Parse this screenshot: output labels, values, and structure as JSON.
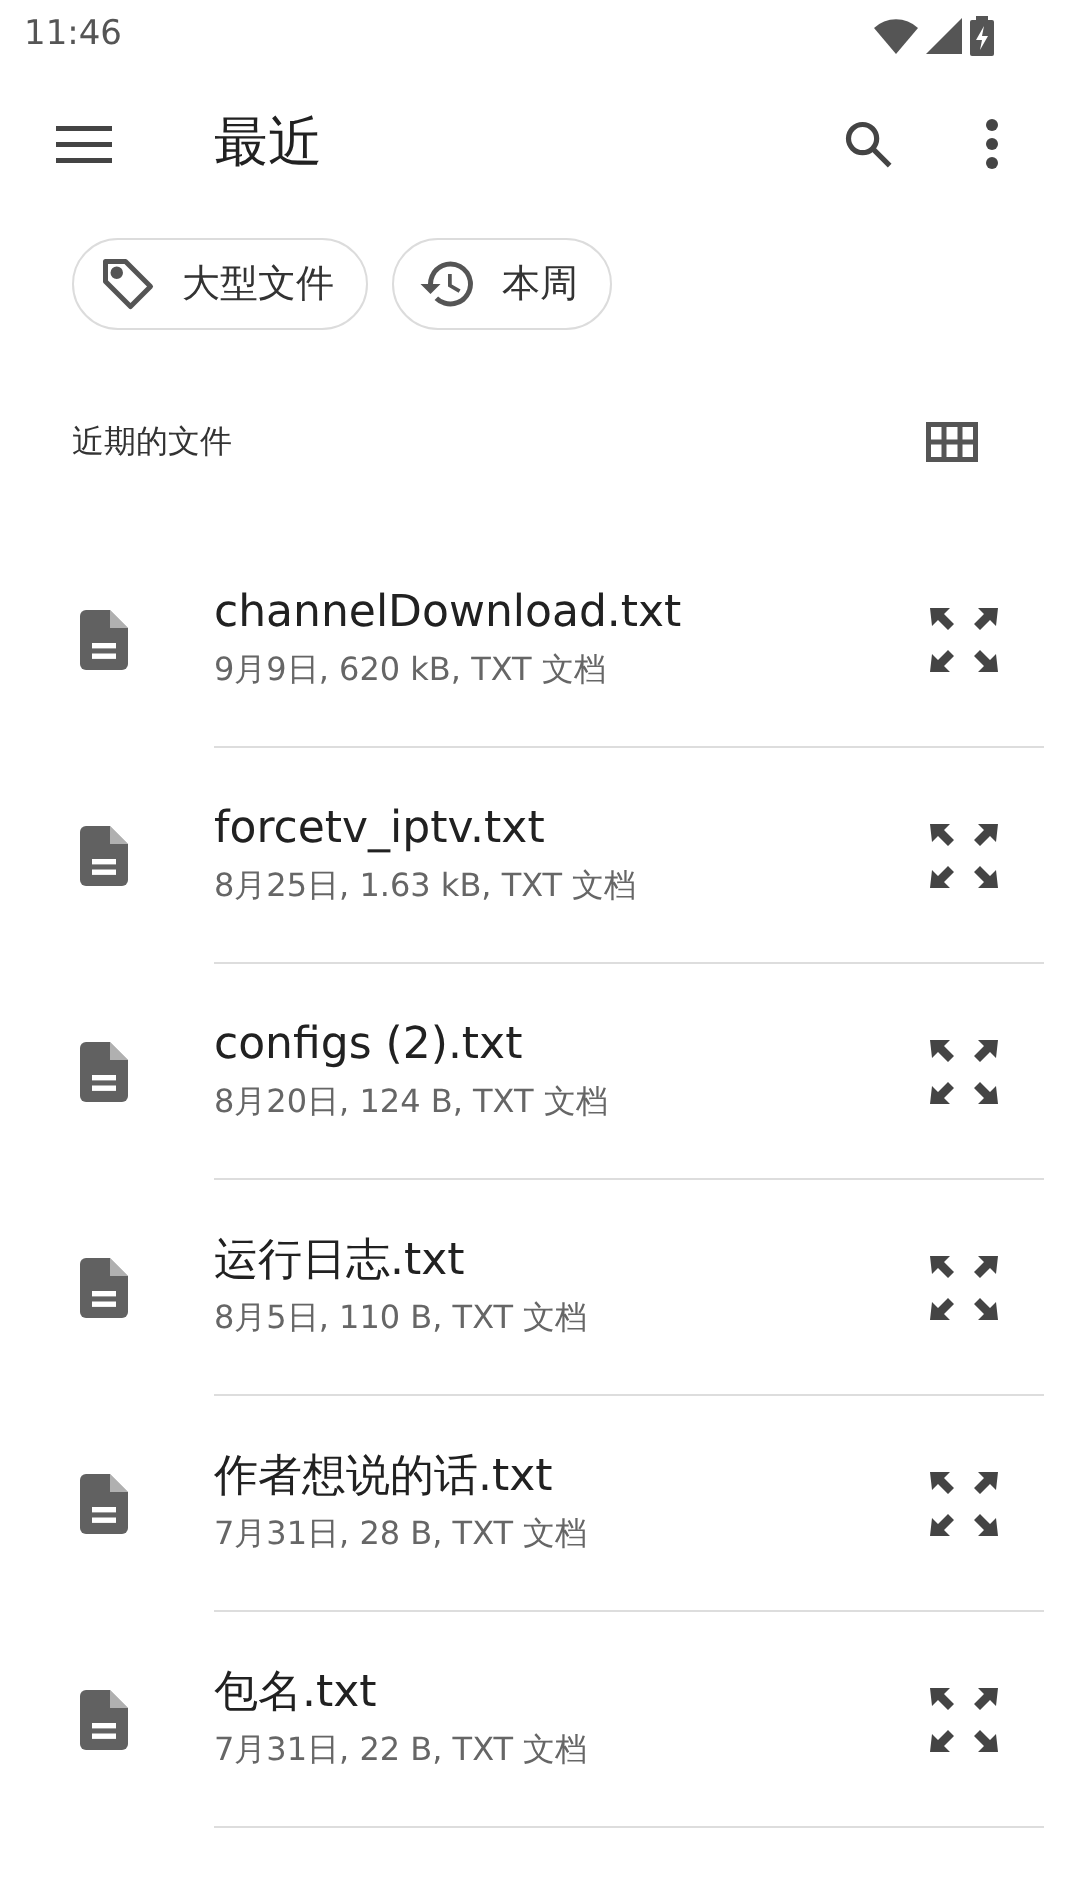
{
  "status_bar": {
    "time": "11:46"
  },
  "toolbar": {
    "title": "最近"
  },
  "chips": [
    {
      "kind": "tag",
      "label": "大型文件"
    },
    {
      "kind": "history",
      "label": "本周"
    }
  ],
  "section": {
    "title": "近期的文件"
  },
  "files": [
    {
      "name": "channelDownload.txt",
      "details": "9月9日, 620 kB, TXT 文档"
    },
    {
      "name": "forcetv_iptv.txt",
      "details": "8月25日, 1.63 kB, TXT 文档"
    },
    {
      "name": "configs (2).txt",
      "details": "8月20日, 124 B, TXT 文档"
    },
    {
      "name": "运行日志.txt",
      "details": "8月5日, 110 B, TXT 文档"
    },
    {
      "name": "作者想说的话.txt",
      "details": "7月31日, 28 B, TXT 文档"
    },
    {
      "name": "包名.txt",
      "details": "7月31日, 22 B, TXT 文档"
    }
  ]
}
